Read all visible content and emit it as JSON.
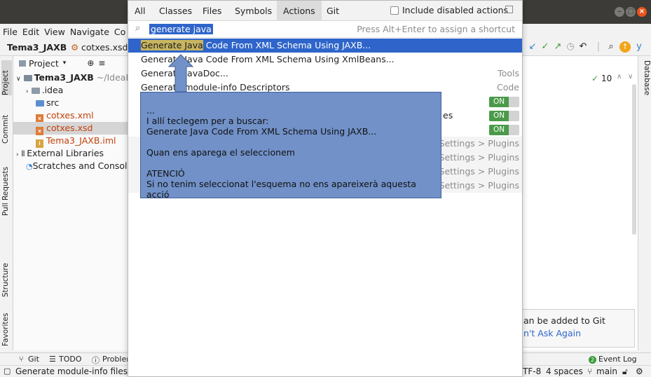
{
  "window": {
    "buttons": [
      "–",
      "□",
      "×"
    ]
  },
  "menubar": {
    "items": [
      "File",
      "Edit",
      "View",
      "Navigate",
      "Co"
    ]
  },
  "toolbar": {
    "project": "Tema3_JAXB",
    "file": "cotxes.xsd",
    "right_icon_tail": "y"
  },
  "left_strip": {
    "tabs": [
      "Project",
      "Commit",
      "Pull Requests",
      "Structure",
      "Favorites"
    ]
  },
  "right_strip": {
    "tabs": [
      "Database"
    ]
  },
  "project_panel": {
    "title": "Project",
    "tree": [
      {
        "label": "Tema3_JAXB",
        "suffix": "~/IdeaP",
        "kind": "module"
      },
      {
        "label": ".idea",
        "kind": "folder"
      },
      {
        "label": "src",
        "kind": "folder"
      },
      {
        "label": "cotxes.xml",
        "kind": "xml"
      },
      {
        "label": "cotxes.xsd",
        "kind": "xsd"
      },
      {
        "label": "Tema3_JAXB.iml",
        "kind": "iml"
      },
      {
        "label": "External Libraries",
        "kind": "lib"
      },
      {
        "label": "Scratches and Consoles",
        "kind": "scratch"
      }
    ]
  },
  "editor": {
    "inspections_count": "10"
  },
  "popup": {
    "tabs": [
      "All",
      "Classes",
      "Files",
      "Symbols",
      "Actions",
      "Git"
    ],
    "active_tab": "Actions",
    "include_disabled": "Include disabled actions",
    "search_value": "generate java",
    "shortcut_hint": "Press Alt+Enter to assign a shortcut",
    "results": [
      {
        "highlight": "Generate Java",
        "rest": " Code From XML Schema Using JAXB...",
        "right": ""
      },
      {
        "highlight": "",
        "rest": "Generate Java Code From XML Schema Using XmlBeans...",
        "right": ""
      },
      {
        "highlight": "",
        "rest": "Generate JavaDoc...",
        "right": "Tools"
      },
      {
        "highlight": "",
        "rest": "Generate module-info Descriptors",
        "right": "Code"
      },
      {
        "highlight": "",
        "rest": "",
        "right": "ON"
      },
      {
        "highlight": "",
        "rest": "es",
        "right": "ON"
      },
      {
        "highlight": "",
        "rest": "",
        "right": "ON"
      },
      {
        "highlight": "",
        "rest": "",
        "right": "Settings > Plugins"
      },
      {
        "highlight": "",
        "rest": "",
        "right": "Settings > Plugins"
      },
      {
        "highlight": "",
        "rest": "",
        "right": "Settings > Plugins"
      },
      {
        "highlight": "",
        "rest": "",
        "right": "Settings > Plugins"
      }
    ]
  },
  "annotation": {
    "lines": [
      "...",
      "I allí teclegem per a buscar:",
      "Generate Java Code From XML Schema Using JAXB...",
      "",
      "Quan ens aparega el seleccionem",
      "",
      "ATENCIÓ",
      "Si no tenim seleccionat l'esquema no ens apareixerà aquesta acció"
    ]
  },
  "git_notification": {
    "line1": "an be added to Git",
    "line2": "n't Ask Again"
  },
  "bottom_tabs": {
    "git": "Git",
    "todo": "TODO",
    "problems": "Problen",
    "event_log": "Event Log"
  },
  "status": {
    "message": "Generate module-info files f",
    "encoding": "TF-8",
    "indent": "4 spaces",
    "branch": "main"
  },
  "colors": {
    "selection": "#2f65ca",
    "match_highlight": "#c7b560",
    "annotation_fill": "#7191c8",
    "toggle_on": "#4a9a4a"
  }
}
